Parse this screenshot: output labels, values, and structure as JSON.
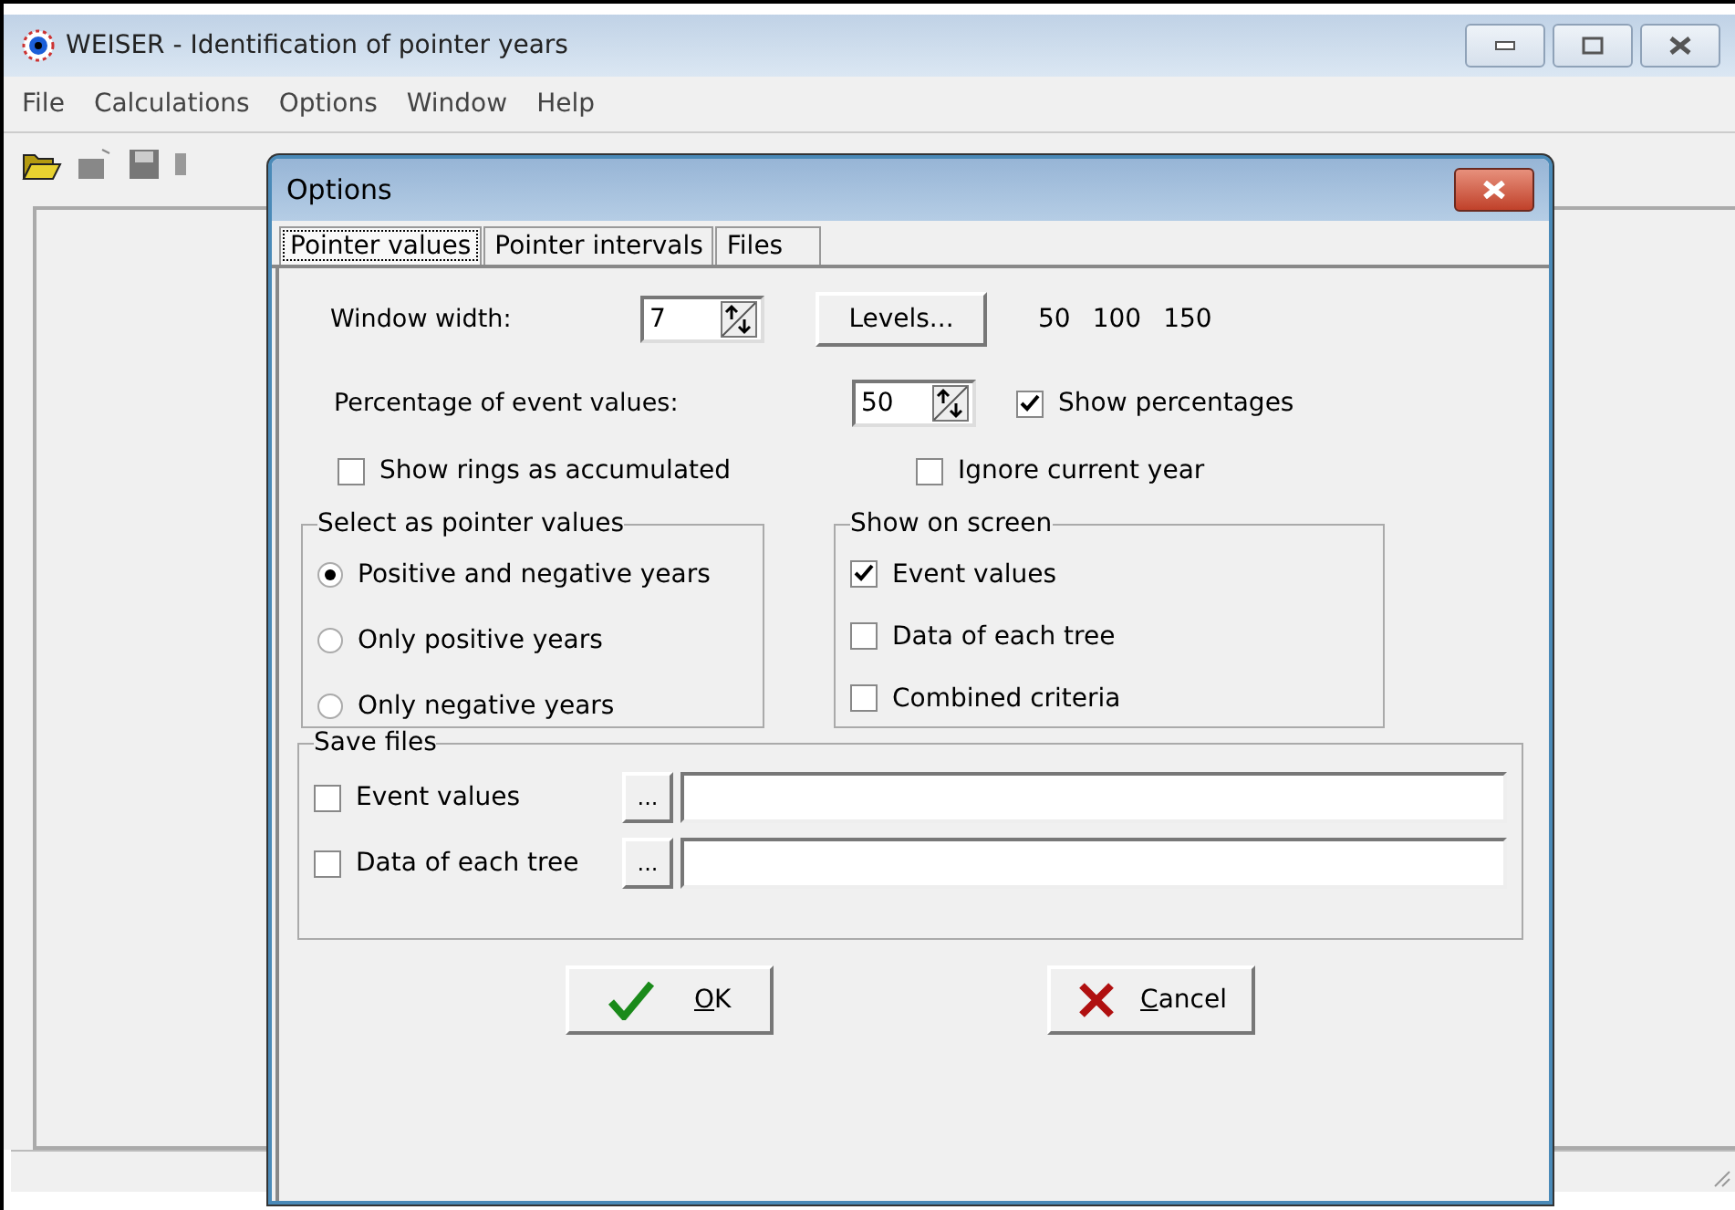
{
  "window": {
    "title": "WEISER - Identification of pointer years"
  },
  "menu": [
    "File",
    "Calculations",
    "Options",
    "Window",
    "Help"
  ],
  "dialog": {
    "title": "Options",
    "tabs": [
      {
        "label": "Pointer values",
        "selected": true
      },
      {
        "label": "Pointer intervals",
        "selected": false
      },
      {
        "label": "Files",
        "selected": false
      }
    ],
    "window_width": {
      "label": "Window width:",
      "value": "7"
    },
    "levels_button": "Levels...",
    "levels": [
      "50",
      "100",
      "150"
    ],
    "percentage": {
      "label": "Percentage of event values:",
      "value": "50"
    },
    "show_percentages": {
      "label": "Show percentages",
      "checked": true
    },
    "show_rings": {
      "label": "Show rings as accumulated",
      "checked": false
    },
    "ignore_current": {
      "label": "Ignore current year",
      "checked": false
    },
    "pointer_group": {
      "title": "Select as pointer values",
      "options": [
        {
          "label": "Positive and negative years",
          "selected": true
        },
        {
          "label": "Only positive years",
          "selected": false
        },
        {
          "label": "Only negative years",
          "selected": false
        }
      ]
    },
    "screen_group": {
      "title": "Show on screen",
      "options": [
        {
          "label": "Event values",
          "checked": true
        },
        {
          "label": "Data of each tree",
          "checked": false
        },
        {
          "label": "Combined criteria",
          "checked": false
        }
      ]
    },
    "save_group": {
      "title": "Save files",
      "rows": [
        {
          "label": "Event values",
          "checked": false,
          "browse": "..."
        },
        {
          "label": "Data of each tree",
          "checked": false,
          "browse": "..."
        }
      ]
    },
    "ok": "OK",
    "cancel": "Cancel"
  }
}
